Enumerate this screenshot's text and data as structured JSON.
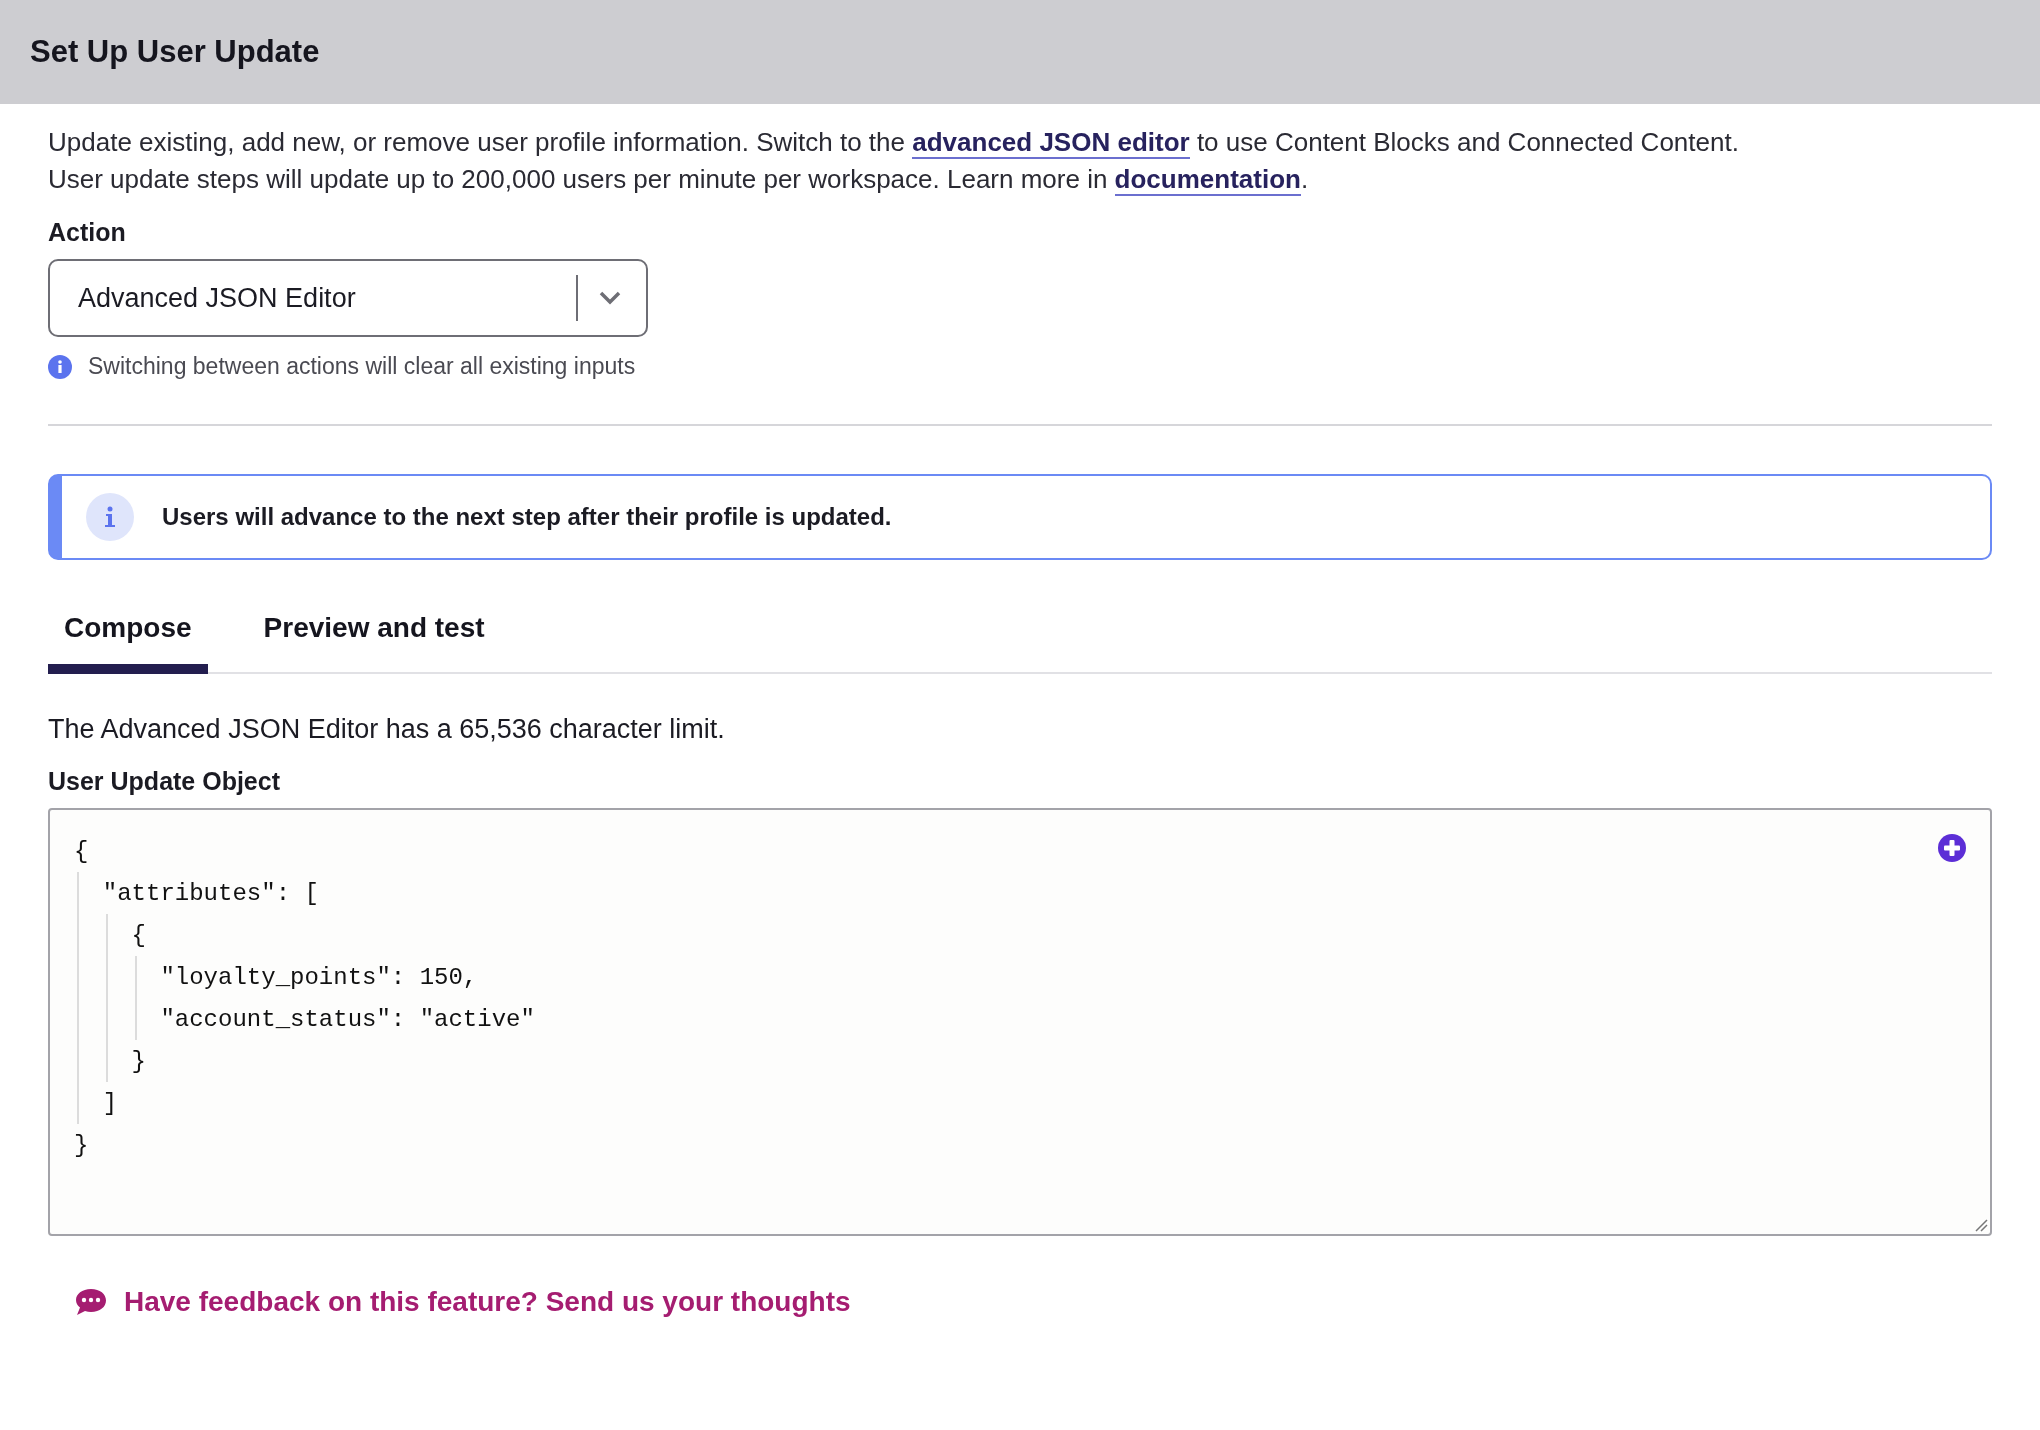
{
  "header": {
    "title": "Set Up User Update"
  },
  "description": {
    "lines": [
      [
        {
          "kind": "text",
          "text": "Update existing, add new, or remove user profile information. Switch to the "
        },
        {
          "kind": "link",
          "text": "advanced JSON editor"
        },
        {
          "kind": "text",
          "text": " to use Content Blocks and Connected Content."
        }
      ],
      [
        {
          "kind": "text",
          "text": "User update steps will update up to 200,000 users per minute per workspace. Learn more in "
        },
        {
          "kind": "link",
          "text": "documentation"
        },
        {
          "kind": "text",
          "text": "."
        }
      ]
    ]
  },
  "action": {
    "label": "Action",
    "value": "Advanced JSON Editor",
    "hint": "Switching between actions will clear all existing inputs"
  },
  "banner": {
    "text": "Users will advance to the next step after their profile is updated."
  },
  "tabs": [
    {
      "label": "Compose",
      "selected": true
    },
    {
      "label": "Preview and test",
      "selected": false
    }
  ],
  "limit_note": "The Advanced JSON Editor has a 65,536 character limit.",
  "editor": {
    "label": "User Update Object",
    "lines": [
      "{",
      "  \"attributes\": [",
      "    {",
      "      \"loyalty_points\": 150,",
      "      \"account_status\": \"active\"",
      "    }",
      "  ]",
      "}"
    ]
  },
  "feedback": {
    "text": "Have feedback on this feature? Send us your thoughts"
  }
}
